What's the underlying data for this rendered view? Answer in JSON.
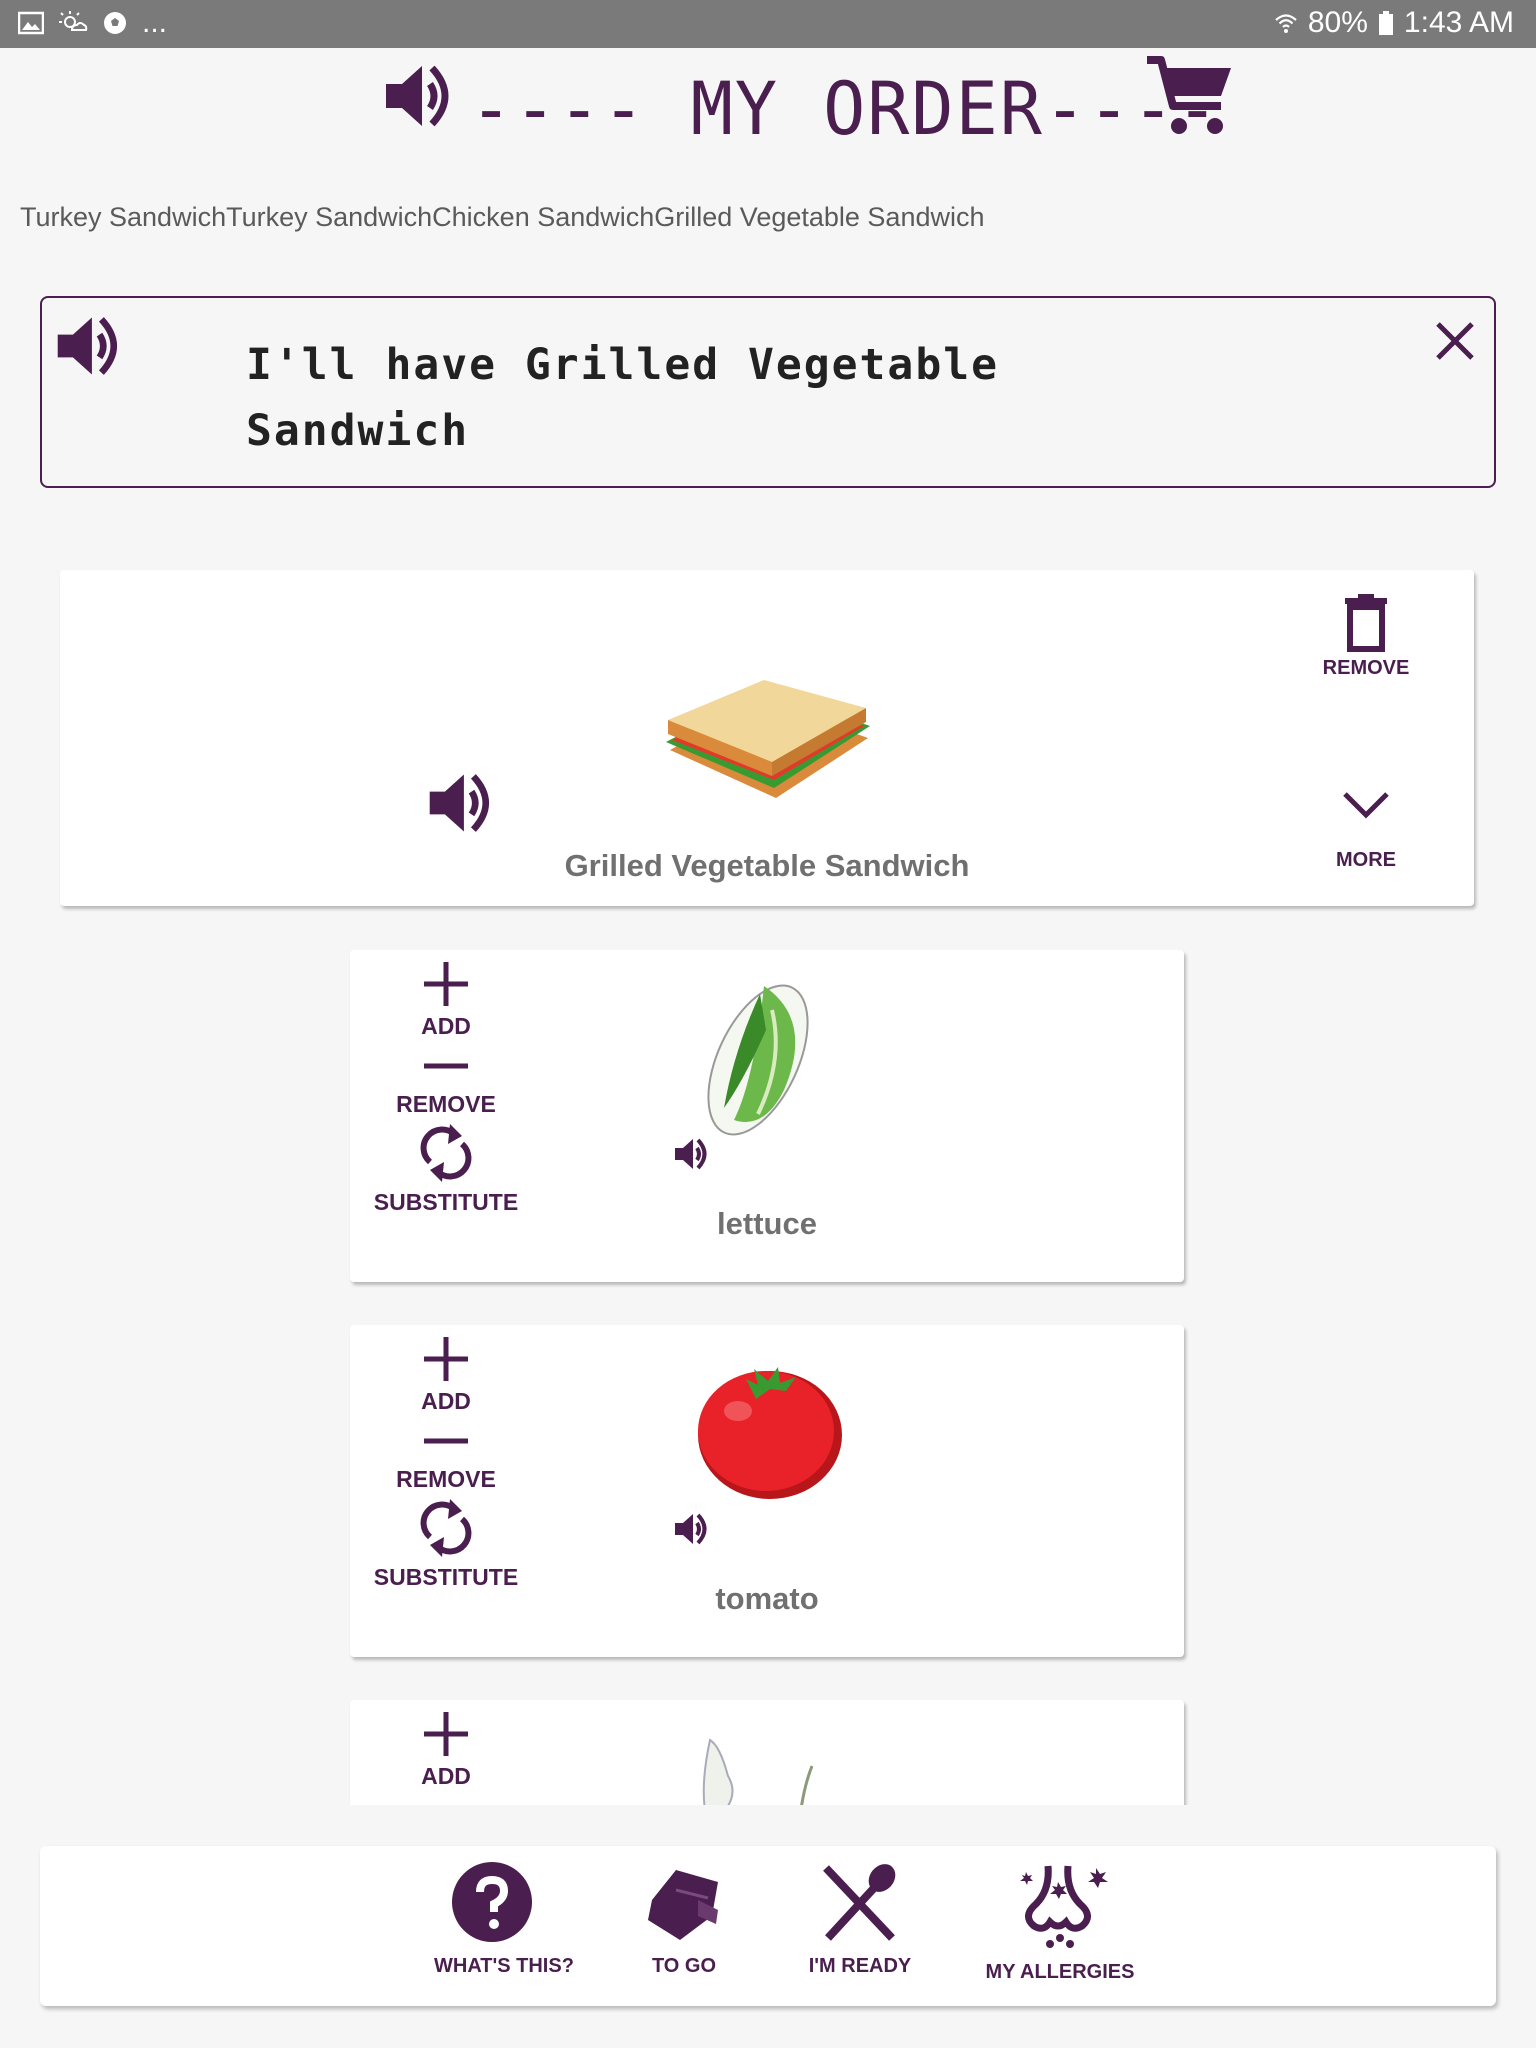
{
  "status_bar": {
    "left_icons": [
      "gallery-icon",
      "weather-icon",
      "soccer-ball-icon"
    ],
    "overflow": "...",
    "battery": "80%",
    "time": "1:43 AM"
  },
  "header": {
    "title": "---- MY ORDER----"
  },
  "history": {
    "text": "Turkey SandwichTurkey SandwichChicken SandwichGrilled Vegetable Sandwich"
  },
  "phrase": {
    "line1": "I'll have Grilled Vegetable",
    "line2": "Sandwich"
  },
  "order_item": {
    "name": "Grilled Vegetable Sandwich",
    "remove_label": "REMOVE",
    "more_label": "MORE"
  },
  "ingredients": [
    {
      "name": "lettuce",
      "add": "ADD",
      "remove": "REMOVE",
      "substitute": "SUBSTITUTE"
    },
    {
      "name": "tomato",
      "add": "ADD",
      "remove": "REMOVE",
      "substitute": "SUBSTITUTE"
    },
    {
      "name": "",
      "add": "ADD"
    }
  ],
  "bottom_bar": {
    "whats_this": "WHAT'S THIS?",
    "to_go": "TO GO",
    "im_ready": "I'M READY",
    "my_allergies": "MY ALLERGIES"
  },
  "colors": {
    "accent": "#4a1e4e",
    "status_bar": "#7a7a7a",
    "background": "#f6f6f6"
  }
}
